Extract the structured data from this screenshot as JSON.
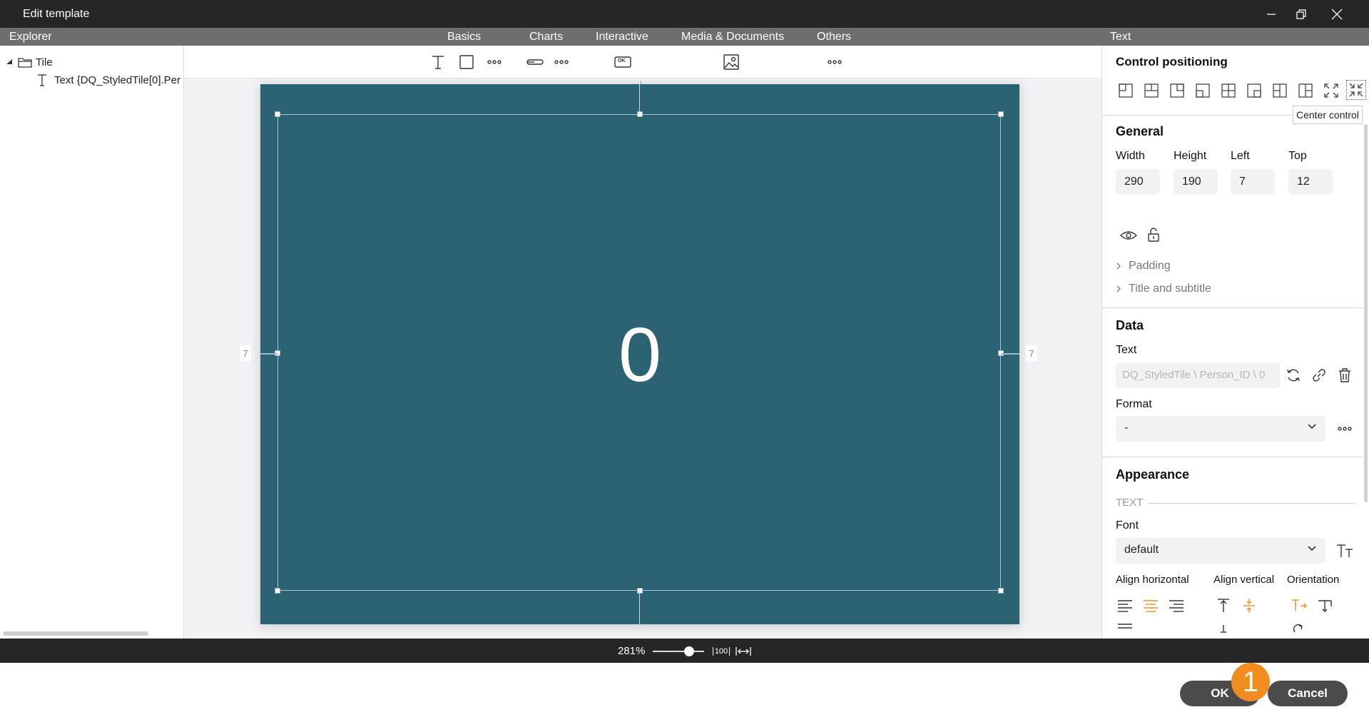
{
  "window": {
    "title": "Edit template"
  },
  "header": {
    "explorer_label": "Explorer",
    "categories": [
      "Basics",
      "Charts",
      "Interactive",
      "Media & Documents",
      "Others"
    ],
    "panel_label": "Text"
  },
  "explorer": {
    "root": "Tile",
    "child": "Text {DQ_StyledTile[0].Per"
  },
  "toolbox": {
    "button_glyph": "OK"
  },
  "canvas": {
    "value": "0",
    "left_margin": "7",
    "right_margin": "7"
  },
  "panel": {
    "positioning_title": "Control positioning",
    "tooltip": "Center control",
    "general_title": "General",
    "width_label": "Width",
    "width": "290",
    "height_label": "Height",
    "height": "190",
    "left_label": "Left",
    "left": "7",
    "top_label": "Top",
    "top": "12",
    "padding": "Padding",
    "title_subtitle": "Title and subtitle",
    "data_title": "Data",
    "text_label": "Text",
    "text_placeholder": "DQ_StyledTile \\ Person_ID \\ 0",
    "format_label": "Format",
    "format_value": "-",
    "appearance_title": "Appearance",
    "text_section": "TEXT",
    "font_label": "Font",
    "font_value": "default",
    "align_h_label": "Align horizontal",
    "align_v_label": "Align vertical",
    "orientation_label": "Orientation"
  },
  "statusbar": {
    "zoom": "281%",
    "zoom_100": "100"
  },
  "footer": {
    "ok": "OK",
    "cancel": "Cancel",
    "step": "1"
  },
  "colors": {
    "tile_bg": "#2b6372",
    "accent": "#f28c1e",
    "dark_bar": "#262626"
  }
}
